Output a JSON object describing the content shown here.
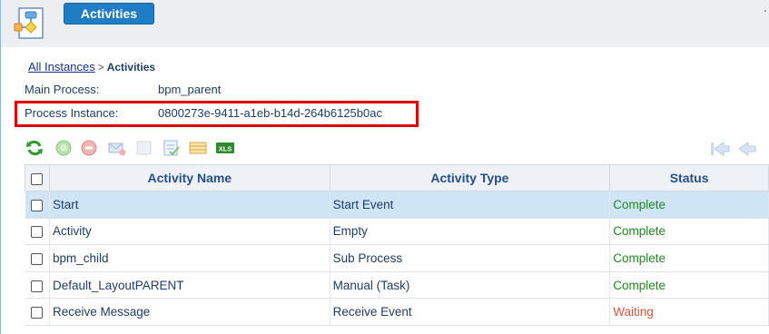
{
  "header": {
    "app_icon": "process-flow-icon",
    "title": "Activities"
  },
  "breadcrumb": {
    "link": "All Instances",
    "separator": ">",
    "current": "Activities"
  },
  "info": {
    "main_process_label": "Main Process:",
    "main_process_value": "bpm_parent",
    "process_instance_label": "Process Instance:",
    "process_instance_value": "0800273e-9411-a1eb-b14d-264b6125b0ac"
  },
  "toolbar": {
    "icons": [
      "refresh-icon",
      "resume-icon",
      "stop-icon",
      "send-mail-icon",
      "blank-icon",
      "edit-form-icon",
      "grid-view-icon",
      "export-xls-icon"
    ],
    "xls_text": "XLS"
  },
  "nav": {
    "icons": [
      "first-page-icon",
      "previous-page-icon"
    ]
  },
  "table": {
    "columns": [
      "Activity Name",
      "Activity Type",
      "Status"
    ],
    "rows": [
      {
        "name": "Start",
        "type": "Start Event",
        "status": "Complete",
        "state": "complete"
      },
      {
        "name": "Activity",
        "type": "Empty",
        "status": "Complete",
        "state": "complete"
      },
      {
        "name": "bpm_child",
        "type": "Sub Process",
        "status": "Complete",
        "state": "complete"
      },
      {
        "name": "Default_LayoutPARENT",
        "type": "Manual (Task)",
        "status": "Complete",
        "state": "complete"
      },
      {
        "name": "Receive Message",
        "type": "Receive Event",
        "status": "Waiting",
        "state": "waiting"
      }
    ],
    "selected_row": 0
  },
  "colors": {
    "accent": "#1e7dc4",
    "complete": "#1e8a1e",
    "waiting": "#e8503a",
    "highlight": "#e00000"
  }
}
